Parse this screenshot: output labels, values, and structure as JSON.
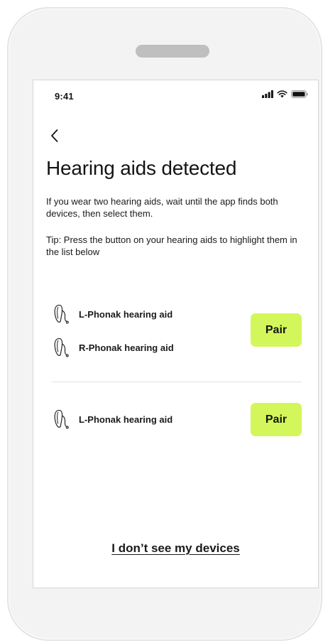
{
  "status_bar": {
    "time": "9:41",
    "icons": [
      "signal-icon",
      "wifi-icon",
      "battery-icon"
    ]
  },
  "header": {
    "back_icon": "chevron-left-icon",
    "title": "Hearing aids detected"
  },
  "instructions": {
    "text": "If you wear two hearing aids, wait until the app finds both devices, then select them.",
    "tip": "Tip: Press the button on your hearing aids to highlight them in the list below"
  },
  "device_groups": [
    {
      "devices": [
        {
          "label": "L-Phonak hearing aid",
          "icon": "hearing-aid-icon"
        },
        {
          "label": "R-Phonak hearing aid",
          "icon": "hearing-aid-icon"
        }
      ],
      "pair_label": "Pair"
    },
    {
      "devices": [
        {
          "label": "L-Phonak hearing aid",
          "icon": "hearing-aid-icon"
        }
      ],
      "pair_label": "Pair"
    }
  ],
  "footer": {
    "no_devices_link": "I don’t see my devices"
  },
  "colors": {
    "pair_button": "#d3f75a",
    "text": "#141414",
    "device_bezel": "#f3f3f3"
  }
}
